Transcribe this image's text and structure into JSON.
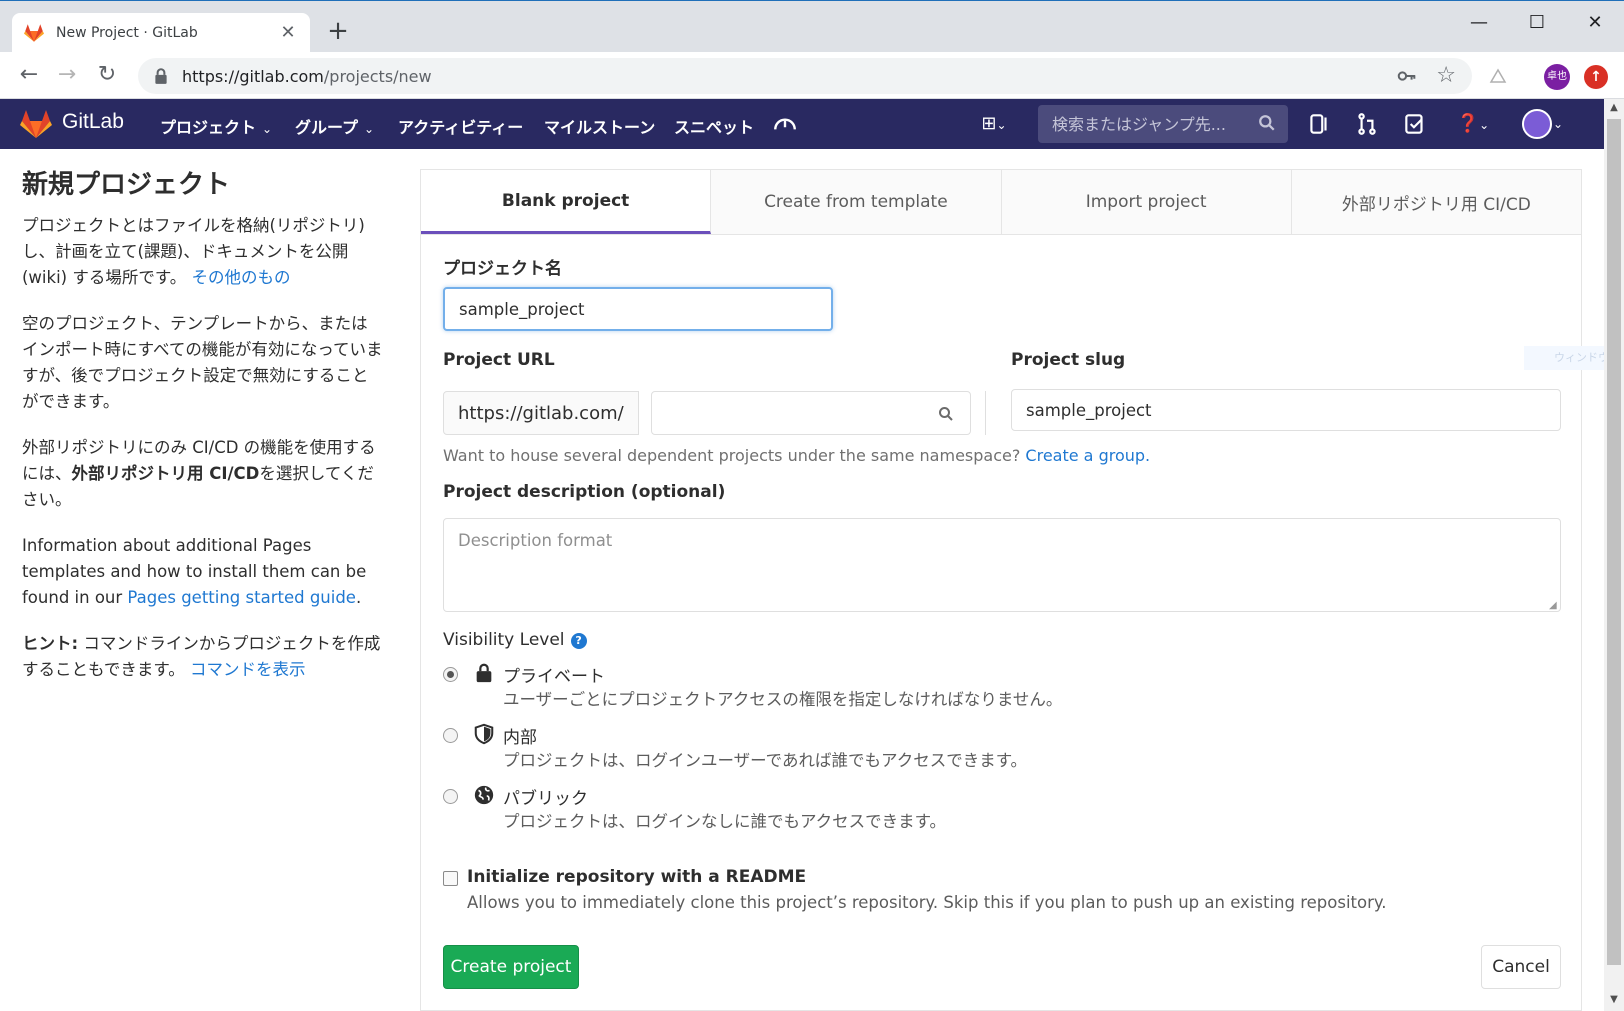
{
  "browser": {
    "tab_title": "New Project · GitLab",
    "url_host": "https://gitlab.com",
    "url_path": "/projects/new",
    "profile_initials": "卓也"
  },
  "navbar": {
    "brand": "GitLab",
    "links": [
      "プロジェクト",
      "グループ",
      "アクティビティー",
      "マイルストーン",
      "スニペット"
    ],
    "search_placeholder": "検索またはジャンプ先...",
    "colors": {
      "background": "#292961",
      "search_bg": "#4b4b7c"
    }
  },
  "sidebar": {
    "title": "新規プロジェクト",
    "p1": "プロジェクトとはファイルを格納(リポジトリ)し、計画を立て(課題)、ドキュメントを公開(wiki) する場所です。",
    "p1_link": "その他のもの",
    "p2": "空のプロジェクト、テンプレートから、またはインポート時にすべての機能が有効になっていますが、後でプロジェクト設定で無効にすることができます。",
    "p3_a": "外部リポジトリにのみ CI/CD の機能を使用するには、",
    "p3_bold": "外部リポジトリ用 CI/CD",
    "p3_b": "を選択してください。",
    "p4_a": "Information about additional Pages templates and how to install them can be found in our ",
    "p4_link": "Pages getting started guide",
    "p4_b": ".",
    "hint_label": "ヒント:",
    "hint_text": " コマンドラインからプロジェクトを作成することもできます。 ",
    "hint_link": "コマンドを表示"
  },
  "tabs": [
    "Blank project",
    "Create from template",
    "Import project",
    "外部リポジトリ用 CI/CD"
  ],
  "form": {
    "project_name_label": "プロジェクト名",
    "project_name_value": "sample_project",
    "project_url_label": "Project URL",
    "project_url_prefix": "https://gitlab.com/",
    "project_slug_label": "Project slug",
    "project_slug_value": "sample_project",
    "namespace_help": "Want to house several dependent projects under the same namespace? ",
    "namespace_help_link": "Create a group.",
    "description_label": "Project description (optional)",
    "description_placeholder": "Description format",
    "visibility_label": "Visibility Level",
    "visibility_options": [
      {
        "title": "プライベート",
        "desc": "ユーザーごとにプロジェクトアクセスの権限を指定しなければなりません。",
        "icon": "lock-icon",
        "checked": true
      },
      {
        "title": "内部",
        "desc": "プロジェクトは、ログインユーザーであれば誰でもアクセスできます。",
        "icon": "shield-icon",
        "checked": false
      },
      {
        "title": "パブリック",
        "desc": "プロジェクトは、ログインなしに誰でもアクセスできます。",
        "icon": "globe-icon",
        "checked": false
      }
    ],
    "readme_title": "Initialize repository with a README",
    "readme_desc": "Allows you to immediately clone this project’s repository. Skip this if you plan to push up an existing repository.",
    "create_button": "Create project",
    "cancel_button": "Cancel"
  },
  "overlay_text": "ウィンドウの"
}
